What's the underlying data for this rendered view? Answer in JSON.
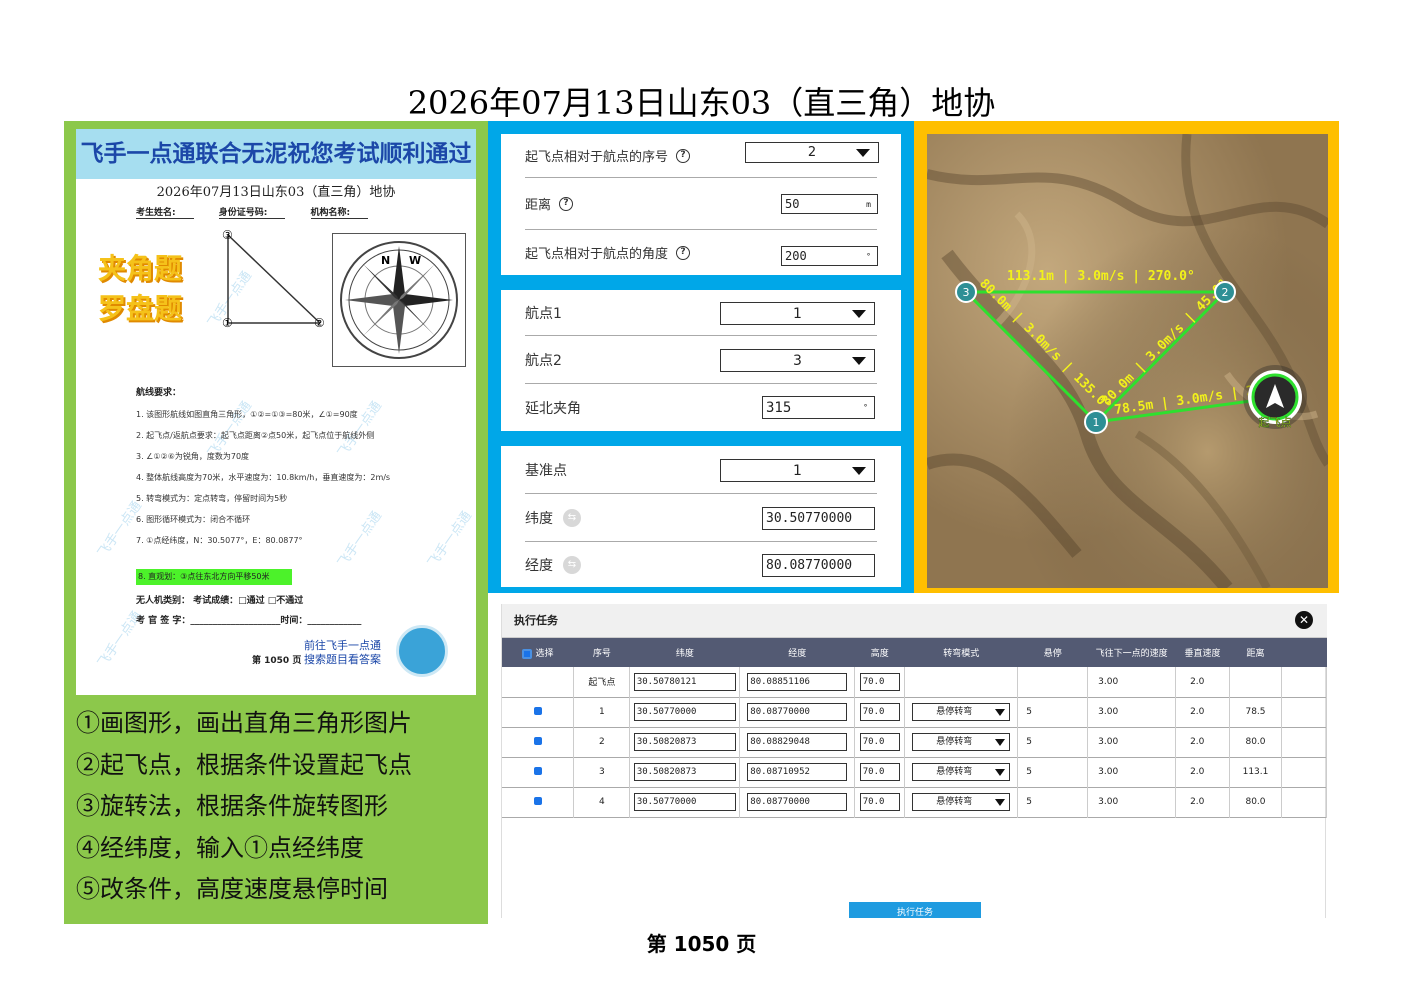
{
  "page_title": "2026年07月13日山东03（直三角）地协",
  "footer_page": "第 1050 页",
  "paper": {
    "banner": "飞手一点通联合无泥祝您考试顺利通过",
    "title": "2026年07月13日山东03（直三角）地协",
    "fields": [
      "考生姓名:",
      "身份证号码:",
      "机构名称:"
    ],
    "tag1": "夹角题",
    "tag2": "罗盘题",
    "diagram_labels": [
      "③",
      "①",
      "②"
    ],
    "compass_letters": [
      "N",
      "W"
    ],
    "req_title": "航线要求：",
    "requirements": [
      "1.  该图形航线如图直角三角形，①②=①③=80米，∠①=90度",
      "2.  起飞点/返航点要求：起飞点距离②点50米，起飞点位于航线外侧",
      "3.  ∠①②⑥为锐角，度数为70度",
      "4.  整体航线高度为70米，水平速度为：10.8km/h，垂直速度为：2m/s",
      "5.  转弯模式为：定点转弯，停留时间为5秒",
      "6.  图形循环模式为：闭合不循环",
      "7.  ①点经纬度，N：30.5077°，E：80.0877°"
    ],
    "highlight": "8. 直观划：③点往东北方向平移50米",
    "bottom_line1": "无人机类别：                    考试成绩：□通过   □不通过",
    "bottom_line2": "考 官 签 字：____________________时间：____________",
    "page": "第 1050 页",
    "promo1": "前往飞手一点通",
    "promo2": "搜索题目看答案",
    "watermark": "飞手一点通"
  },
  "steps": [
    "①画图形，画出直角三角形图片",
    "②起飞点，根据条件设置起飞点",
    "③旋转法，根据条件旋转图形",
    "④经纬度，输入①点经纬度",
    "⑤改条件，高度速度悬停时间"
  ],
  "takeoff_card": {
    "seq_label": "起飞点相对于航点的序号",
    "seq_value": "2",
    "dist_label": "距离",
    "dist_value": "50",
    "dist_unit": "m",
    "angle_label": "起飞点相对于航点的角度",
    "angle_value": "200",
    "angle_unit": "°"
  },
  "rotation_card": {
    "wp1_label": "航点1",
    "wp1_value": "1",
    "wp2_label": "航点2",
    "wp2_value": "3",
    "north_label": "延北夹角",
    "north_value": "315",
    "north_unit": "°"
  },
  "coord_card": {
    "base_label": "基准点",
    "base_value": "1",
    "lat_label": "纬度",
    "lat_value": "30.50770000",
    "lon_label": "经度",
    "lon_value": "80.08770000"
  },
  "map": {
    "labels": {
      "top": "113.1m | 3.0m/s | 270.0°",
      "left": "80.0m | 3.0m/s | 135.0°",
      "right": "80.0m | 3.0m/s | 45.0°",
      "bottom": "78.5m | 3.0m/s | 26",
      "deg": "0°"
    },
    "markers": [
      "1",
      "2",
      "3"
    ],
    "takeoff_label": "起飞点",
    "route_color": "#2ee02e",
    "text_color": "#f2f21a"
  },
  "task": {
    "title": "执行任务",
    "close": "✕",
    "headers": [
      "选择",
      "序号",
      "纬度",
      "经度",
      "高度",
      "转弯模式",
      "悬停",
      "飞往下一点的速度",
      "垂直速度",
      "距离"
    ],
    "takeoff_row": {
      "seq": "起飞点",
      "lat": "30.50780121",
      "lon": "80.08851106",
      "alt": "70.0",
      "speed": "3.00",
      "vspeed": "2.0"
    },
    "rows": [
      {
        "seq": "1",
        "lat": "30.50770000",
        "lon": "80.08770000",
        "alt": "70.0",
        "mode": "悬停转弯",
        "hover": "5",
        "speed": "3.00",
        "vspeed": "2.0",
        "dist": "78.5"
      },
      {
        "seq": "2",
        "lat": "30.50820873",
        "lon": "80.08829048",
        "alt": "70.0",
        "mode": "悬停转弯",
        "hover": "5",
        "speed": "3.00",
        "vspeed": "2.0",
        "dist": "80.0"
      },
      {
        "seq": "3",
        "lat": "30.50820873",
        "lon": "80.08710952",
        "alt": "70.0",
        "mode": "悬停转弯",
        "hover": "5",
        "speed": "3.00",
        "vspeed": "2.0",
        "dist": "113.1"
      },
      {
        "seq": "4",
        "lat": "30.50770000",
        "lon": "80.08770000",
        "alt": "70.0",
        "mode": "悬停转弯",
        "hover": "5",
        "speed": "3.00",
        "vspeed": "2.0",
        "dist": "80.0"
      }
    ],
    "exec_button": "执行任务"
  }
}
